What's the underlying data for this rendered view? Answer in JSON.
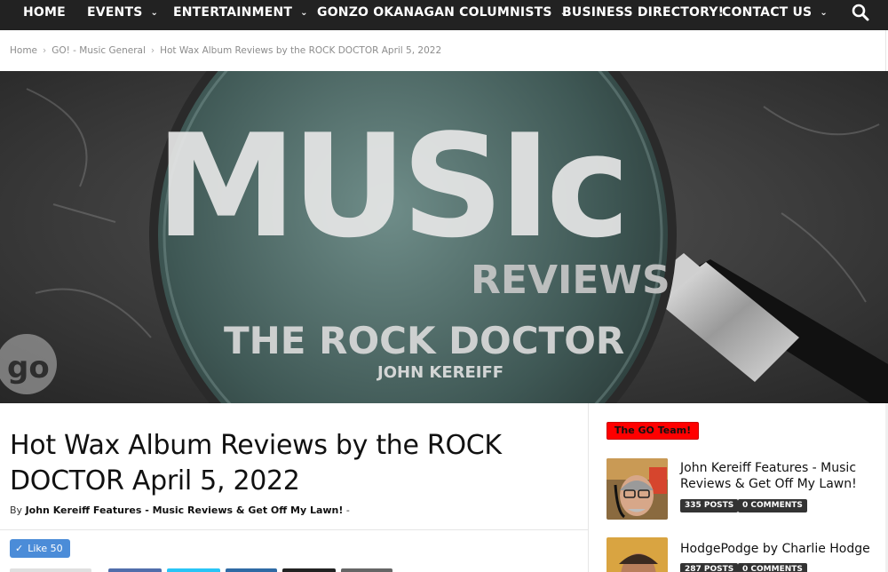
{
  "nav": {
    "items": [
      {
        "label": "HOME",
        "has_dropdown": false
      },
      {
        "label": "EVENTS",
        "has_dropdown": true
      },
      {
        "label": "ENTERTAINMENT",
        "has_dropdown": true
      },
      {
        "label": "GONZO OKANAGAN COLUMNISTS",
        "has_dropdown": true
      },
      {
        "label": "BUSINESS DIRECTORY!",
        "has_dropdown": false
      },
      {
        "label": "CONTACT US",
        "has_dropdown": true
      }
    ],
    "chevron": "⌄",
    "search_icon": "search-icon",
    "background": "#222222"
  },
  "breadcrumb": {
    "items": [
      "Home",
      "GO! - Music General",
      "Hot Wax Album Reviews by the ROCK DOCTOR April 5, 2022"
    ],
    "separator": "›"
  },
  "hero": {
    "title_art": "MUSIc",
    "subtitle": "REVIEWS",
    "show": "THE ROCK DOCTOR",
    "host": "JOHN KEREIFF",
    "logo": "go"
  },
  "article": {
    "title": "Hot Wax Album Reviews by the ROCK DOCTOR April 5, 2022",
    "by_prefix": "By",
    "author": "John Kereiff Features - Music Reviews & Get Off My Lawn!",
    "by_suffix": "-",
    "like_label": "Like",
    "like_count": "50"
  },
  "sidebar": {
    "badge": "The GO Team!",
    "badge_color": "#ff0000",
    "authors": [
      {
        "name": "John Kereiff Features - Music Reviews & Get Off My Lawn!",
        "posts": "335 POSTS",
        "comments": "0 COMMENTS"
      },
      {
        "name": "HodgePodge by Charlie Hodge",
        "posts": "287 POSTS",
        "comments": "0 COMMENTS"
      }
    ]
  },
  "colors": {
    "accent": "#ff0000",
    "facebook": "#4b8cd8",
    "nav": "#222222"
  }
}
